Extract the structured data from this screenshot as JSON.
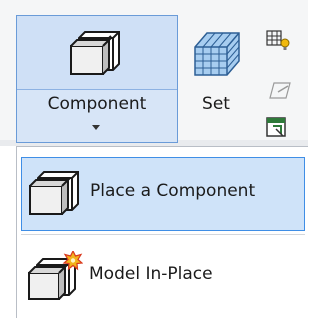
{
  "ribbon": {
    "component_button": {
      "label": "Component",
      "icon": "component-box-icon",
      "dropdown_icon": "caret-down-icon"
    },
    "set_button": {
      "label": "Set",
      "icon": "grid-set-icon"
    },
    "small_icons": [
      "grid-bulb-icon",
      "sketch-plane-icon",
      "viewer-icon"
    ]
  },
  "menu": {
    "items": [
      {
        "label": "Place a Component",
        "icon": "component-box-icon",
        "highlighted": true
      },
      {
        "label": "Model In-Place",
        "icon": "model-in-place-icon",
        "highlighted": false
      }
    ]
  },
  "colors": {
    "highlight_fill": "#cfe3f9",
    "highlight_border": "#3f8ee6",
    "button_border": "#6a9bd8"
  }
}
